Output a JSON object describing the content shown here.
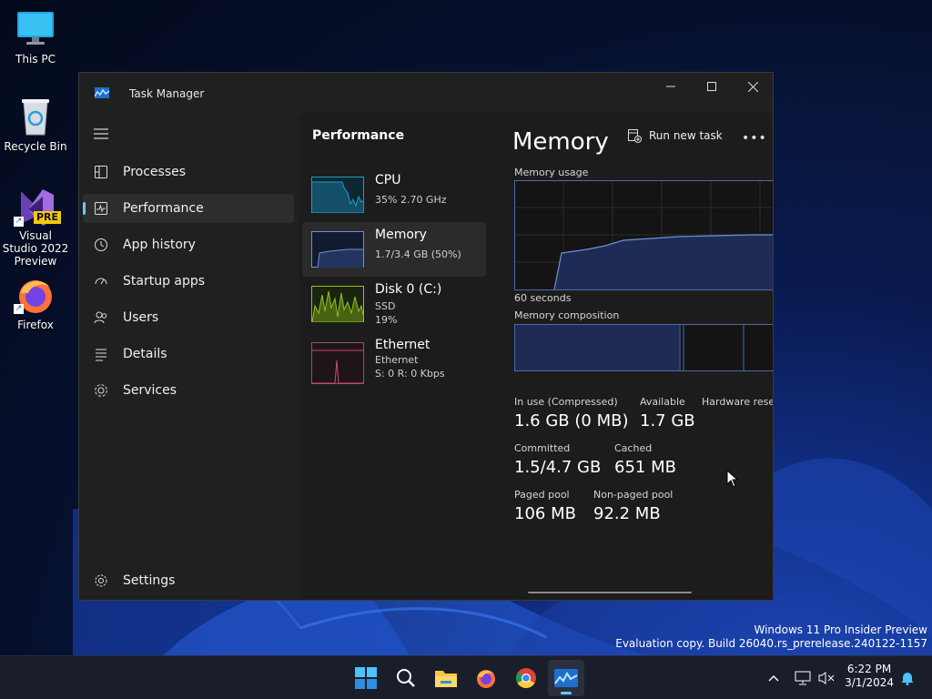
{
  "desktop": {
    "icons": [
      {
        "label": "This PC"
      },
      {
        "label": "Recycle Bin"
      },
      {
        "label": "Visual Studio 2022 Preview",
        "badge": "PRE"
      },
      {
        "label": "Firefox"
      }
    ]
  },
  "window": {
    "title": "Task Manager",
    "nav": [
      {
        "label": "Processes",
        "icon": "processes-icon"
      },
      {
        "label": "Performance",
        "icon": "performance-icon",
        "active": true
      },
      {
        "label": "App history",
        "icon": "app-history-icon"
      },
      {
        "label": "Startup apps",
        "icon": "startup-apps-icon"
      },
      {
        "label": "Users",
        "icon": "users-icon"
      },
      {
        "label": "Details",
        "icon": "details-icon"
      },
      {
        "label": "Services",
        "icon": "services-icon"
      }
    ],
    "settings_label": "Settings"
  },
  "performance": {
    "header": "Performance",
    "run_task_label": "Run new task",
    "more_label": "•••",
    "resources": [
      {
        "name": "CPU",
        "line1": "35%  2.70 GHz",
        "line2": ""
      },
      {
        "name": "Memory",
        "line1": "1.7/3.4 GB (50%)",
        "line2": ""
      },
      {
        "name": "Disk 0 (C:)",
        "line1": "SSD",
        "line2": "19%"
      },
      {
        "name": "Ethernet",
        "line1": "Ethernet",
        "line2": "S: 0  R: 0 Kbps"
      }
    ]
  },
  "memory": {
    "heading": "Memory",
    "usage_label": "Memory usage",
    "seconds_label": "60 seconds",
    "composition_label": "Memory composition",
    "stats": {
      "in_use_label": "In use (Compressed)",
      "in_use": "1.6 GB (0 MB)",
      "available_label": "Available",
      "available": "1.7 GB",
      "hardware_label": "Hardware reser",
      "committed_label": "Committed",
      "committed": "1.5/4.7 GB",
      "cached_label": "Cached",
      "cached": "651 MB",
      "paged_label": "Paged pool",
      "paged": "106 MB",
      "nonpaged_label": "Non-paged pool",
      "nonpaged": "92.2 MB"
    }
  },
  "watermark": {
    "line1": "Windows 11 Pro Insider Preview",
    "line2": "Evaluation copy. Build 26040.rs_prerelease.240122-1157"
  },
  "taskbar": {
    "time": "6:22 PM",
    "date": "3/1/2024"
  },
  "colors": {
    "accent": "#60cdff",
    "cpu_graph": "#17a0c8",
    "memory_graph": "#6f8fd8",
    "disk_graph": "#8fc31f",
    "ethernet_graph": "#d14a6a"
  }
}
